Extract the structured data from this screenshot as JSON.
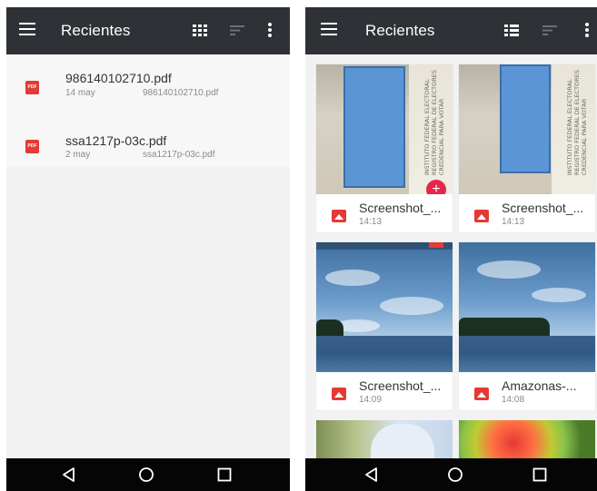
{
  "left_panel": {
    "header": {
      "title": "Recientes"
    },
    "items": [
      {
        "title": "986140102710.pdf",
        "date": "14 may",
        "filename": "986140102710.pdf",
        "icon": "pdf-icon",
        "icon_text": "PDF"
      },
      {
        "title": "ssa1217p-03c.pdf",
        "date": "2 may",
        "filename": "ssa1217p-03c.pdf",
        "icon": "pdf-icon",
        "icon_text": "PDF"
      }
    ]
  },
  "right_panel": {
    "header": {
      "title": "Recientes"
    },
    "cards": [
      {
        "title": "Screenshot_...",
        "time": "14:13"
      },
      {
        "title": "Screenshot_...",
        "time": "14:13"
      },
      {
        "title": "Screenshot_...",
        "time": "14:09"
      },
      {
        "title": "Amazonas-...",
        "time": "14:08"
      }
    ],
    "id_text": [
      "INSTITUTO FEDERAL ELECTORAL",
      "REGISTRO FEDERAL DE ELECTORES",
      "CREDENCIAL PARA VOTAR"
    ]
  },
  "colors": {
    "appbar": "#2e3135",
    "navbar": "#050505",
    "accent_red": "#e53935",
    "fab_red": "#e5264a",
    "redaction_blue": "#5b95d5"
  },
  "icons": {
    "menu": "menu-icon",
    "grid": "grid-view-icon",
    "list": "list-view-icon",
    "sort": "sort-icon",
    "more": "more-vert-icon",
    "back": "nav-back-icon",
    "home": "nav-home-icon",
    "recents": "nav-recents-icon"
  }
}
